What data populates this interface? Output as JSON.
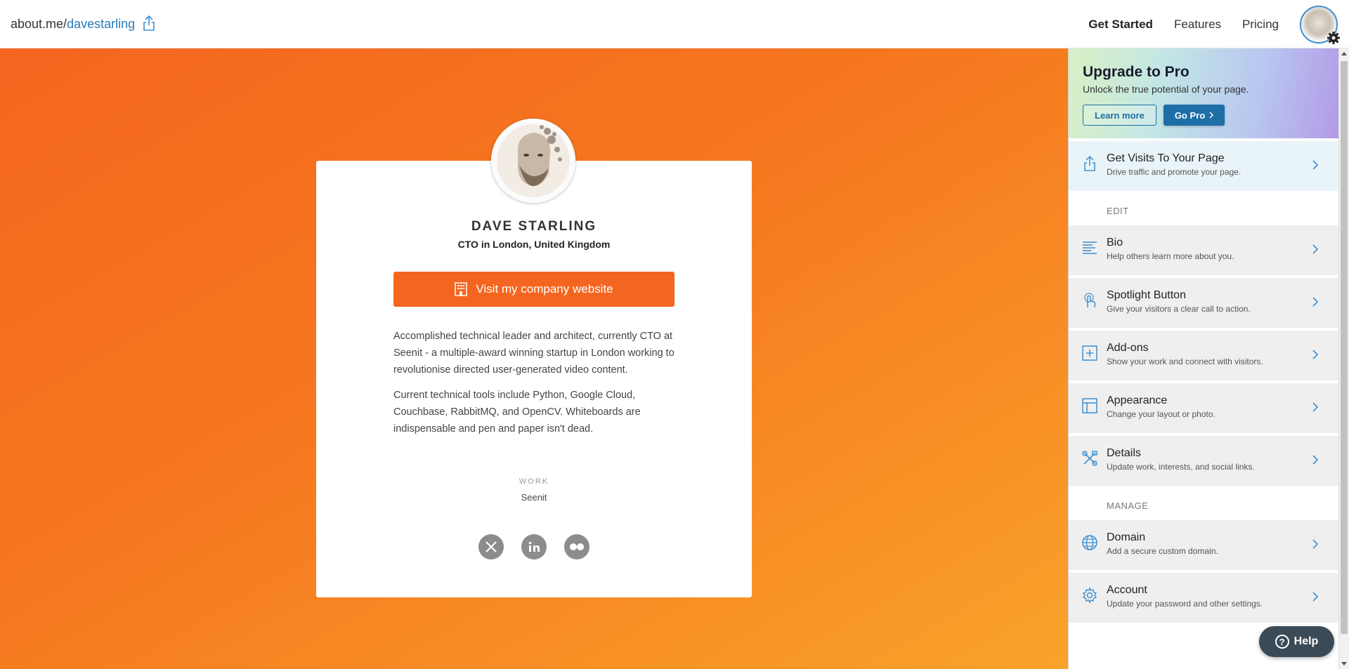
{
  "header": {
    "url_prefix": "about.me/",
    "url_user": "davestarling",
    "nav": [
      "Get Started",
      "Features",
      "Pricing"
    ]
  },
  "profile": {
    "name": "DAVE STARLING",
    "headline": "CTO in London, United Kingdom",
    "cta_label": "Visit my company website",
    "bio": [
      "Accomplished technical leader and architect, currently CTO at Seenit - a multiple-award winning startup in London working to revolutionise directed user-generated video content.",
      "Current technical tools include Python, Google Cloud, Couchbase, RabbitMQ, and OpenCV. Whiteboards are indispensable and pen and paper isn't dead."
    ],
    "work_label": "WORK",
    "work_value": "Seenit",
    "socials": [
      "x-icon",
      "linkedin-icon",
      "flickr-icon"
    ]
  },
  "panel": {
    "pro_title": "Upgrade to Pro",
    "pro_sub": "Unlock the true potential of your page.",
    "learn_more": "Learn more",
    "go_pro": "Go Pro",
    "visits": {
      "title": "Get Visits To Your Page",
      "sub": "Drive traffic and promote your page."
    },
    "edit_label": "EDIT",
    "edit_items": [
      {
        "title": "Bio",
        "sub": "Help others learn more about you."
      },
      {
        "title": "Spotlight Button",
        "sub": "Give your visitors a clear call to action."
      },
      {
        "title": "Add-ons",
        "sub": "Show your work and connect with visitors."
      },
      {
        "title": "Appearance",
        "sub": "Change your layout or photo."
      },
      {
        "title": "Details",
        "sub": "Update work, interests, and social links."
      }
    ],
    "manage_label": "MANAGE",
    "manage_items": [
      {
        "title": "Domain",
        "sub": "Add a secure custom domain."
      },
      {
        "title": "Account",
        "sub": "Update your password and other settings."
      }
    ]
  },
  "help_label": "Help",
  "colors": {
    "accent": "#f4651f",
    "link": "#2a7ab8",
    "pro_button": "#1e6fa8"
  }
}
